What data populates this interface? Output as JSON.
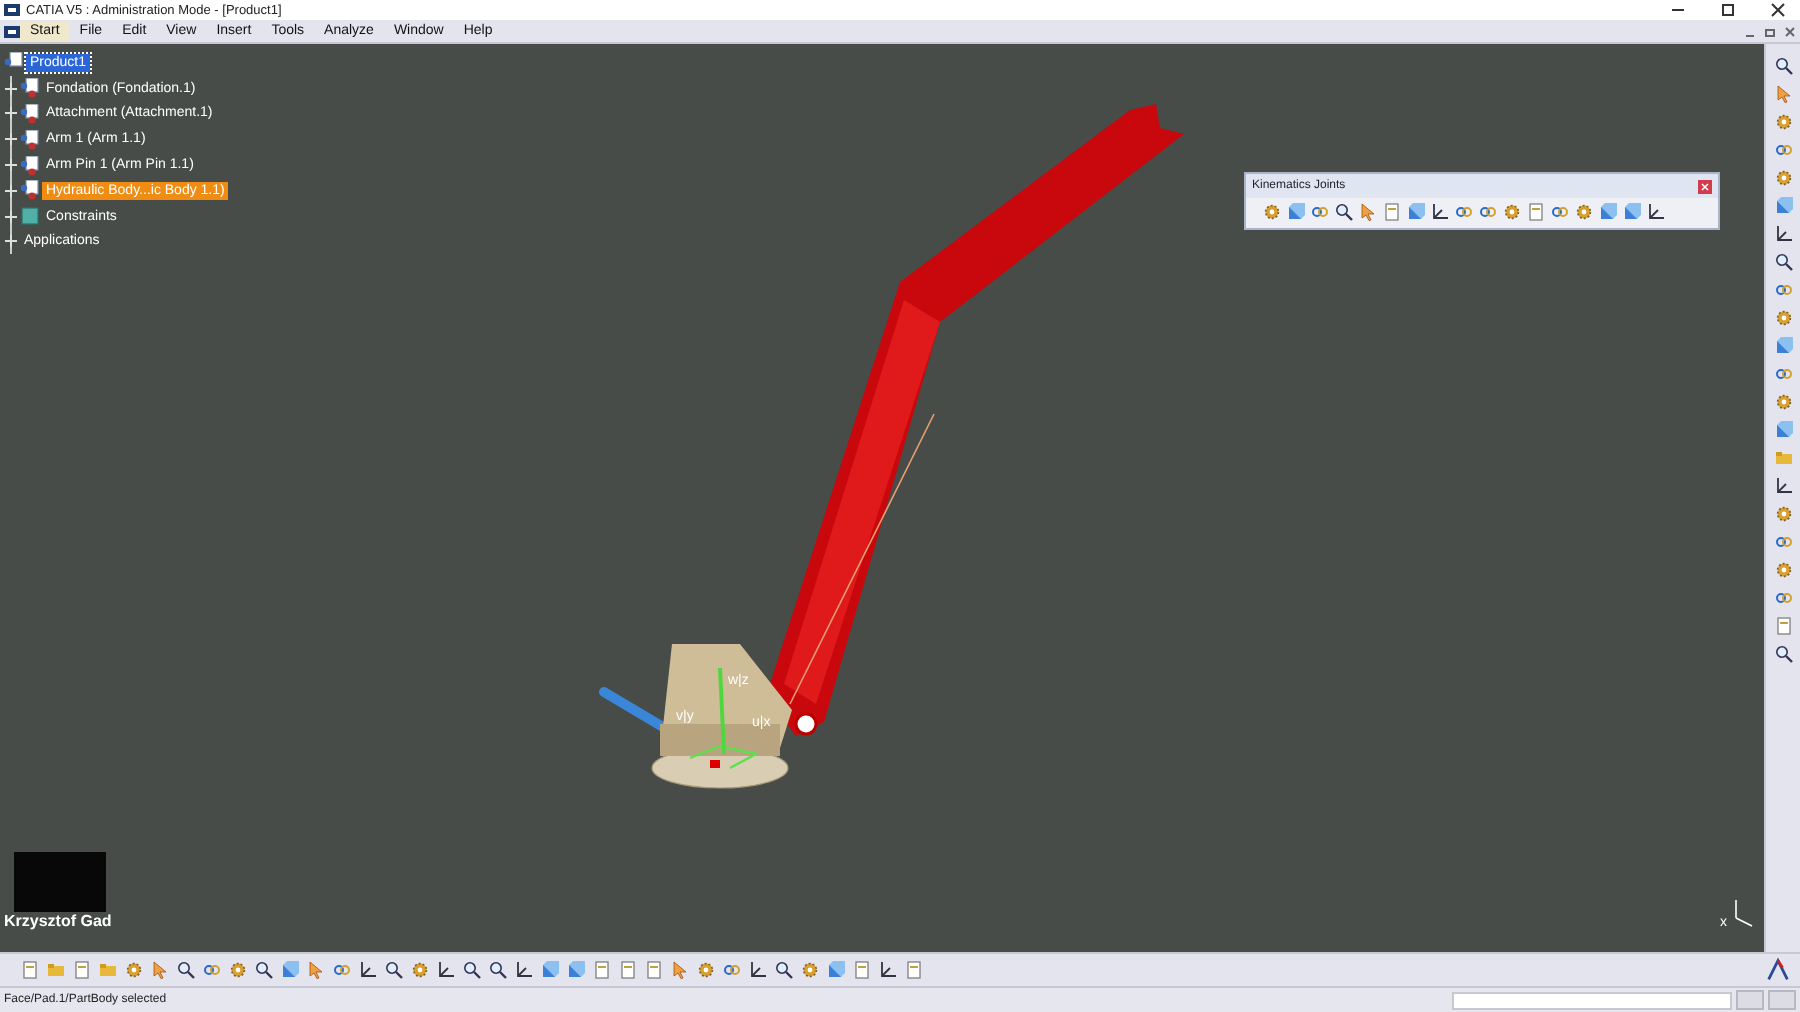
{
  "window": {
    "title": "CATIA V5 : Administration Mode - [Product1]"
  },
  "menu": [
    {
      "label": "Start",
      "selected": true
    },
    {
      "label": "File",
      "selected": false
    },
    {
      "label": "Edit",
      "selected": false
    },
    {
      "label": "View",
      "selected": false
    },
    {
      "label": "Insert",
      "selected": false
    },
    {
      "label": "Tools",
      "selected": false
    },
    {
      "label": "Analyze",
      "selected": false
    },
    {
      "label": "Window",
      "selected": false
    },
    {
      "label": "Help",
      "selected": false
    }
  ],
  "tree": {
    "label": "Product1",
    "kind": "product",
    "selected": true,
    "highlighted": false,
    "children": [
      {
        "label": "Fondation (Fondation.1)",
        "kind": "part",
        "selected": false,
        "highlighted": false
      },
      {
        "label": "Attachment (Attachment.1)",
        "kind": "part",
        "selected": false,
        "highlighted": false
      },
      {
        "label": "Arm 1 (Arm 1.1)",
        "kind": "part",
        "selected": false,
        "highlighted": false
      },
      {
        "label": "Arm Pin 1 (Arm Pin 1.1)",
        "kind": "part",
        "selected": false,
        "highlighted": false
      },
      {
        "label": "Hydraulic Body...ic Body 1.1)",
        "kind": "part",
        "selected": false,
        "highlighted": true
      },
      {
        "label": "Constraints",
        "kind": "constraints",
        "selected": false,
        "highlighted": false
      },
      {
        "label": "Applications",
        "kind": "applications",
        "selected": false,
        "highlighted": false
      }
    ]
  },
  "kinematics_toolbar": {
    "title": "Kinematics Joints"
  },
  "model": {
    "labels": [
      "w|z",
      "v|y",
      "u|x"
    ]
  },
  "compass": {
    "label": "x"
  },
  "webcam": {
    "caption": "Krzysztof Gad"
  },
  "status_bar": {
    "message": "Face/Pad.1/PartBody selected"
  }
}
